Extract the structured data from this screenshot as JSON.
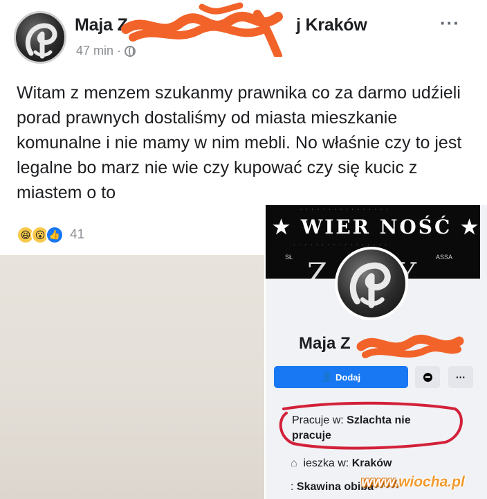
{
  "post": {
    "author_prefix": "Maja Z",
    "author_suffix": "j Kraków",
    "time": "47 min",
    "separator": "·",
    "more": "···",
    "text": "Witam z menzem szukanmy prawnika co za darmo udźieli porad prawnych dostaliśmy od miasta mieszkanie komunalne i nie mamy w nim mebli. No właśnie czy to jest legalne bo marz nie wie czy kupować czy się kucic z miastem o to",
    "reaction_count": "41",
    "reactions": [
      "haha-icon",
      "wow-icon",
      "like-icon"
    ]
  },
  "profile": {
    "cover_title": "★ WIER NOŚĆ ★",
    "cover_big": "Z   DY",
    "cover_small_left": "SŁ",
    "cover_small_right": "ASSA",
    "name": "Maja Z",
    "add_button": "Dodaj",
    "more_button": "···",
    "work_label": "Pracuje w:",
    "work_value": "Szlachta nie pracuje",
    "lives_label": "ieszka w:",
    "lives_value": "Kraków",
    "relation_value": "Skawina obiba"
  },
  "watermark": {
    "prefix": "www.",
    "domain": "wiocha.pl"
  },
  "colors": {
    "facebook_blue": "#1877f2",
    "scribble_orange": "#f2632a",
    "circle_red": "#d3213a"
  }
}
